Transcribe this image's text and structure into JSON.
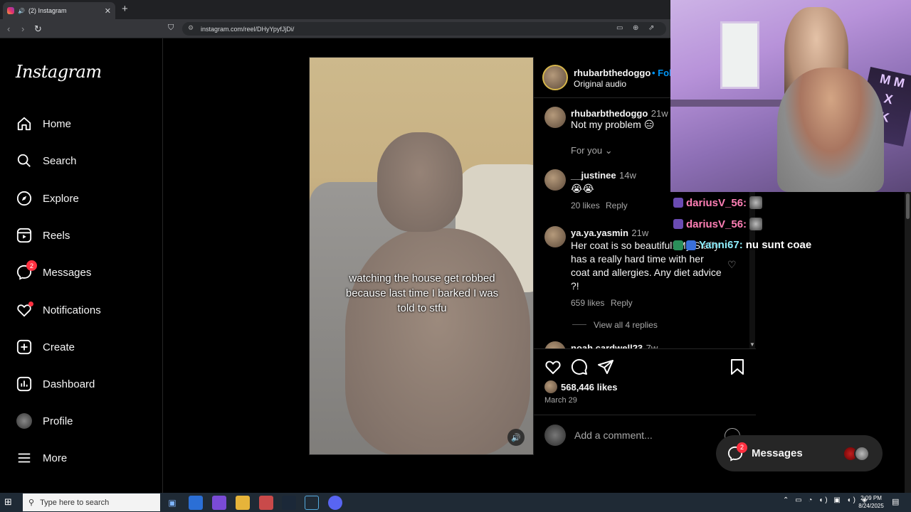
{
  "browser": {
    "tab_title": "(2) Instagram",
    "new_tab": "+",
    "tab_close": "✕",
    "url": "instagram.com/reel/DHyYpyfJjDi/"
  },
  "sidebar": {
    "logo": "Instagram",
    "items": [
      {
        "label": "Home",
        "icon": "home-icon"
      },
      {
        "label": "Search",
        "icon": "search-icon"
      },
      {
        "label": "Explore",
        "icon": "compass-icon"
      },
      {
        "label": "Reels",
        "icon": "reels-icon"
      },
      {
        "label": "Messages",
        "icon": "messenger-icon",
        "badge": "2"
      },
      {
        "label": "Notifications",
        "icon": "heart-icon"
      },
      {
        "label": "Create",
        "icon": "plus-square-icon"
      },
      {
        "label": "Dashboard",
        "icon": "chart-icon"
      },
      {
        "label": "Profile",
        "icon": "avatar-icon"
      },
      {
        "label": "More",
        "icon": "hamburger-icon"
      }
    ]
  },
  "reel": {
    "caption": "watching the house get robbed because last time I barked I was told to stfu"
  },
  "post": {
    "username": "rhubarbthedoggo",
    "follow": "• Fol",
    "audio": "Original audio",
    "likes": "568,446 likes",
    "date": "March 29",
    "add_comment_placeholder": "Add a comment..."
  },
  "comments": [
    {
      "user": "rhubarbthedoggo",
      "time": "21w",
      "text": "Not my problem 😑"
    },
    {
      "filter": "For you"
    },
    {
      "user": "__justinee",
      "time": "14w",
      "text": "😭😭",
      "likes": "20 likes",
      "reply": "Reply"
    },
    {
      "user": "ya.ya.yasmin",
      "time": "21w",
      "text": "Her coat is so beautiful! My Staffy has a really hard time with her coat and allergies. Any diet advice ?!",
      "likes": "659 likes",
      "reply": "Reply",
      "view_replies": "View all 4 replies"
    },
    {
      "user": "noah cardwell23",
      "time": "7w"
    }
  ],
  "chat": [
    {
      "name": "dariusV_56:",
      "color": "#ff7fb5"
    },
    {
      "name": "dariusV_56:",
      "color": "#ff7fb5"
    },
    {
      "name": "Yanni67:",
      "message": "nu sunt coae",
      "color": "#8ff0ff"
    }
  ],
  "messages_pill": {
    "label": "Messages",
    "badge": "2"
  },
  "taskbar": {
    "search_placeholder": "Type here to search",
    "time": "2:09 PM",
    "date": "8/24/2025"
  }
}
